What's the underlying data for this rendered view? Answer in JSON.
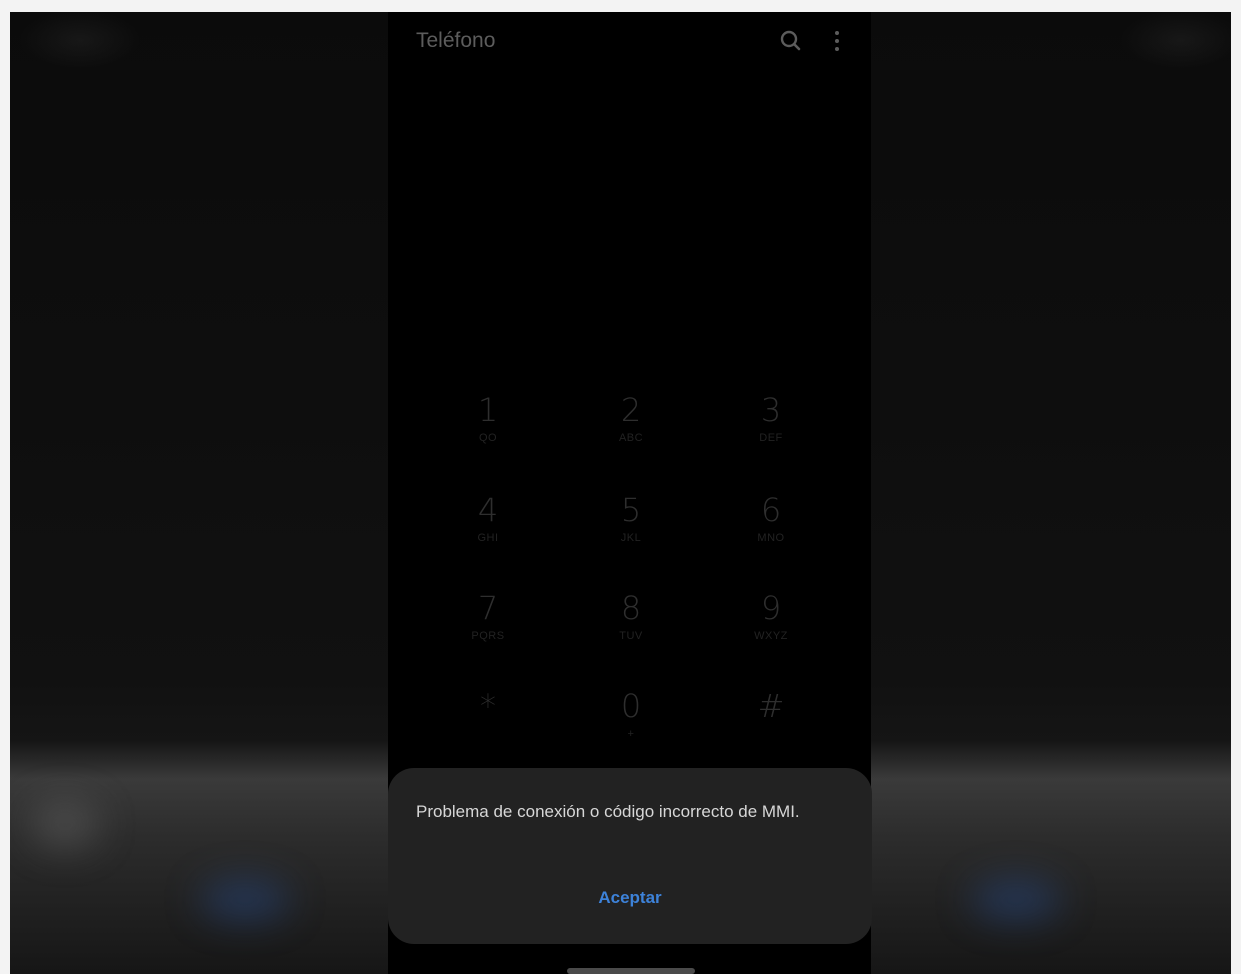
{
  "app": {
    "title": "Teléfono"
  },
  "toolbar": {
    "search_icon": "search-icon",
    "menu_icon": "more-vert-icon"
  },
  "dialpad": {
    "keys": [
      {
        "digit": "1",
        "letters": "QO"
      },
      {
        "digit": "2",
        "letters": "ABC"
      },
      {
        "digit": "3",
        "letters": "DEF"
      },
      {
        "digit": "4",
        "letters": "GHI"
      },
      {
        "digit": "5",
        "letters": "JKL"
      },
      {
        "digit": "6",
        "letters": "MNO"
      },
      {
        "digit": "7",
        "letters": "PQRS"
      },
      {
        "digit": "8",
        "letters": "TUV"
      },
      {
        "digit": "9",
        "letters": "WXYZ"
      },
      {
        "digit": "*",
        "letters": ""
      },
      {
        "digit": "0",
        "letters": "+"
      },
      {
        "digit": "#",
        "letters": ""
      }
    ]
  },
  "dialog": {
    "message": "Problema de conexión o código incorrecto de MMI.",
    "button_label": "Aceptar"
  },
  "colors": {
    "accent": "#3d82d9",
    "dialog_bg": "#222222"
  }
}
